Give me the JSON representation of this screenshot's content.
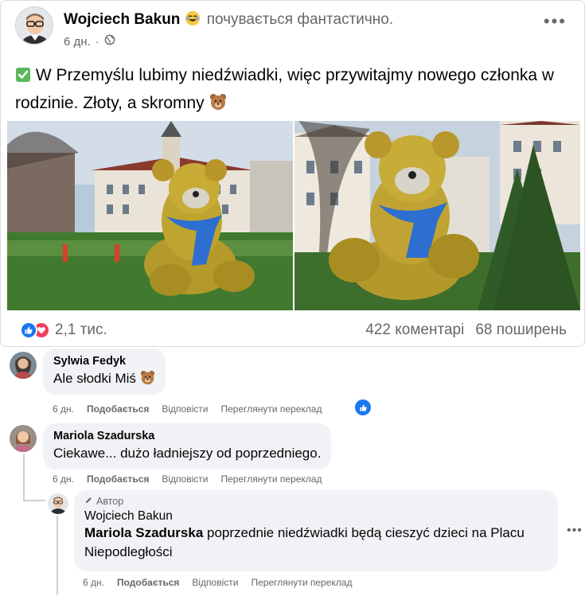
{
  "post": {
    "author": "Wojciech Bakun",
    "feeling": "почувається фантастично.",
    "time": "6 дн.",
    "privacy_icon": "globe-icon",
    "text": "W Przemyślu lubimy niedźwiadki, więc przywitajmy nowego członka w rodzinie. Złoty, a skromny",
    "reactions_count": "2,1 тис.",
    "comments_count": "422 коментарі",
    "shares_count": "68 поширень"
  },
  "comments": [
    {
      "author": "Sylwia Fedyk",
      "text": "Ale słodki Miś",
      "time": "6 дн.",
      "like": "Подобається",
      "reply": "Відповісти",
      "translate": "Переглянути переклад"
    },
    {
      "author": "Mariola Szadurska",
      "text": "Ciekawe... dużo ładniejszy od poprzedniego.",
      "time": "6 дн.",
      "like": "Подобається",
      "reply": "Відповісти",
      "translate": "Переглянути переклад"
    }
  ],
  "reply": {
    "badge": "Автор",
    "author": "Wojciech Bakun",
    "mention": "Mariola Szadurska",
    "text": "poprzednie niedźwiadki będą cieszyć dzieci na Placu Niepodległości",
    "time": "6 дн.",
    "like": "Подобається",
    "reply": "Відповісти",
    "translate": "Переглянути переклад"
  },
  "colors": {
    "accent": "#1877f2",
    "love": "#f33e58",
    "secondary_text": "#65676b",
    "bubble": "#f0f2f5"
  }
}
